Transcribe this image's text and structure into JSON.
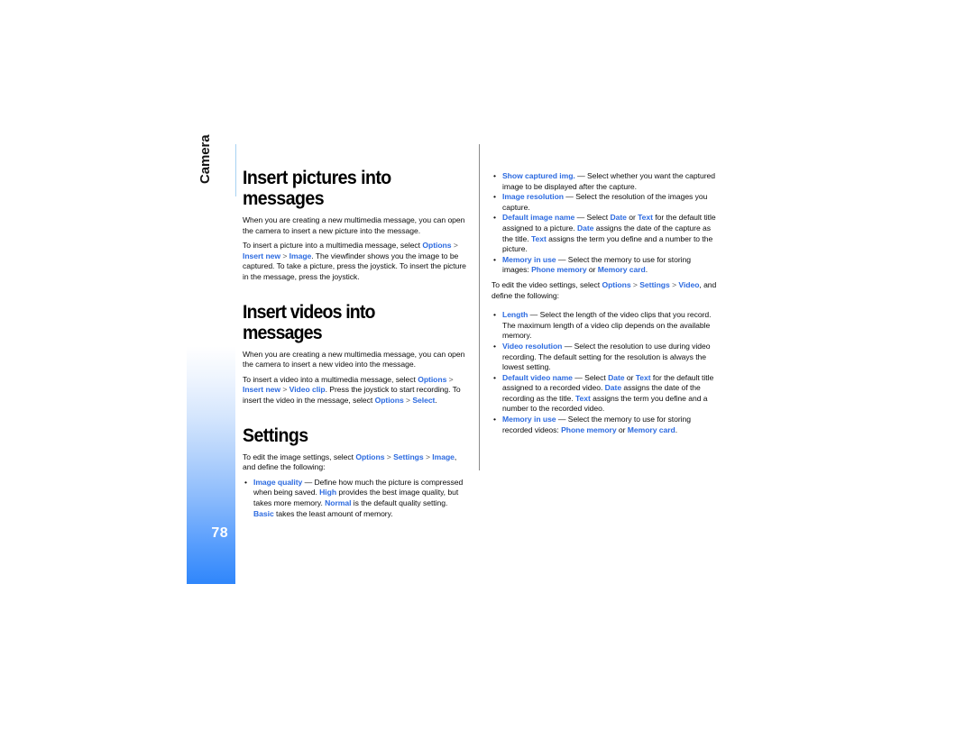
{
  "page": {
    "number": "78",
    "chapter": "Camera",
    "accent_blue": "#2d6be0",
    "tab_gradient_end": "#2f86fb"
  },
  "left_column": {
    "heading1": "Insert pictures into messages",
    "p1": "When you are creating a new multimedia message, you can open the camera to insert a new picture into the message.",
    "p2_lead": "To insert a picture into a multimedia message, select ",
    "p2_opt": "Options",
    "p2_gt1": " > ",
    "p2_insert": "Insert new",
    "p2_gt2": " > ",
    "p2_image": "Image",
    "p2_tail": ". The viewfinder shows you the image to be captured. To take a picture, press the joystick. To insert the picture in the message, press the joystick.",
    "heading2": "Insert videos into messages",
    "p3": "When you are creating a new multimedia message, you can open the camera to insert a new video into the message.",
    "p4_lead": "To insert a video into a multimedia message, select ",
    "p4_opt": "Options",
    "p4_gt1": " > ",
    "p4_insert": "Insert new",
    "p4_gt2": " > ",
    "p4_video": "Video clip",
    "p4_mid": ". Press the joystick to start recording. To insert the video in the message, select ",
    "p4_opt2": "Options",
    "p4_gt3": " > ",
    "p4_select": "Select",
    "p4_tail": ".",
    "heading3": "Settings",
    "p5_lead": "To edit the image settings, select ",
    "p5_opt": "Options",
    "p5_gt1": " > ",
    "p5_settings": "Settings",
    "p5_gt2": " > ",
    "p5_image": "Image",
    "p5_tail": ", and define the following:",
    "bullet1": {
      "term": "Image quality",
      "dash": " — ",
      "t1": "Define how much the picture is compressed when being saved. ",
      "k1": "High",
      "t2": " provides the best image quality, but takes more memory. ",
      "k2": "Normal",
      "t3": " is the default quality setting. ",
      "k3": "Basic",
      "t4": " takes the least amount of memory."
    }
  },
  "right_column": {
    "bullet1": {
      "term": "Show captured img.",
      "dash": " — ",
      "t1": "Select whether you want the captured image to be displayed after the capture."
    },
    "bullet2": {
      "term": "Image resolution",
      "dash": " — ",
      "t1": "Select the resolution of the images you capture."
    },
    "bullet3": {
      "term": "Default image name",
      "dash": " — ",
      "t1": "Select ",
      "k1": "Date",
      "t2": " or ",
      "k2": "Text",
      "t3": " for the default title assigned to a picture. ",
      "k3": "Date",
      "t4": " assigns the date of the capture as the title. ",
      "k4": "Text",
      "t5": " assigns the term you define and a number to the picture."
    },
    "bullet4": {
      "term": "Memory in use",
      "dash": " — ",
      "t1": "Select the memory to use for storing images: ",
      "k1": "Phone memory",
      "t2": " or ",
      "k2": "Memory card",
      "t3": "."
    },
    "p_video_lead": "To edit the video settings, select ",
    "p_video_opt": "Options",
    "p_video_gt1": " > ",
    "p_video_settings": "Settings",
    "p_video_gt2": " > ",
    "p_video_video": "Video",
    "p_video_tail": ", and define the following:",
    "bullet5": {
      "term": "Length",
      "dash": " — ",
      "t1": "Select the length of the video clips that you record. The maximum length of a video clip depends on the available memory."
    },
    "bullet6": {
      "term": "Video resolution",
      "dash": " — ",
      "t1": "Select the resolution to use during video recording. The default setting for the resolution is always the lowest setting."
    },
    "bullet7": {
      "term": "Default video name",
      "dash": " — ",
      "t1": "Select ",
      "k1": "Date",
      "t2": " or ",
      "k2": "Text",
      "t3": " for the default title assigned to a recorded video. ",
      "k3": "Date",
      "t4": " assigns the date of the recording as the title. ",
      "k4": "Text",
      "t5": " assigns the term you define and a number to the recorded video."
    },
    "bullet8": {
      "term": "Memory in use",
      "dash": " — ",
      "t1": "Select the memory to use for storing recorded videos: ",
      "k1": "Phone memory",
      "t2": " or ",
      "k2": "Memory card",
      "t3": "."
    },
    "bullet_char": "•"
  }
}
